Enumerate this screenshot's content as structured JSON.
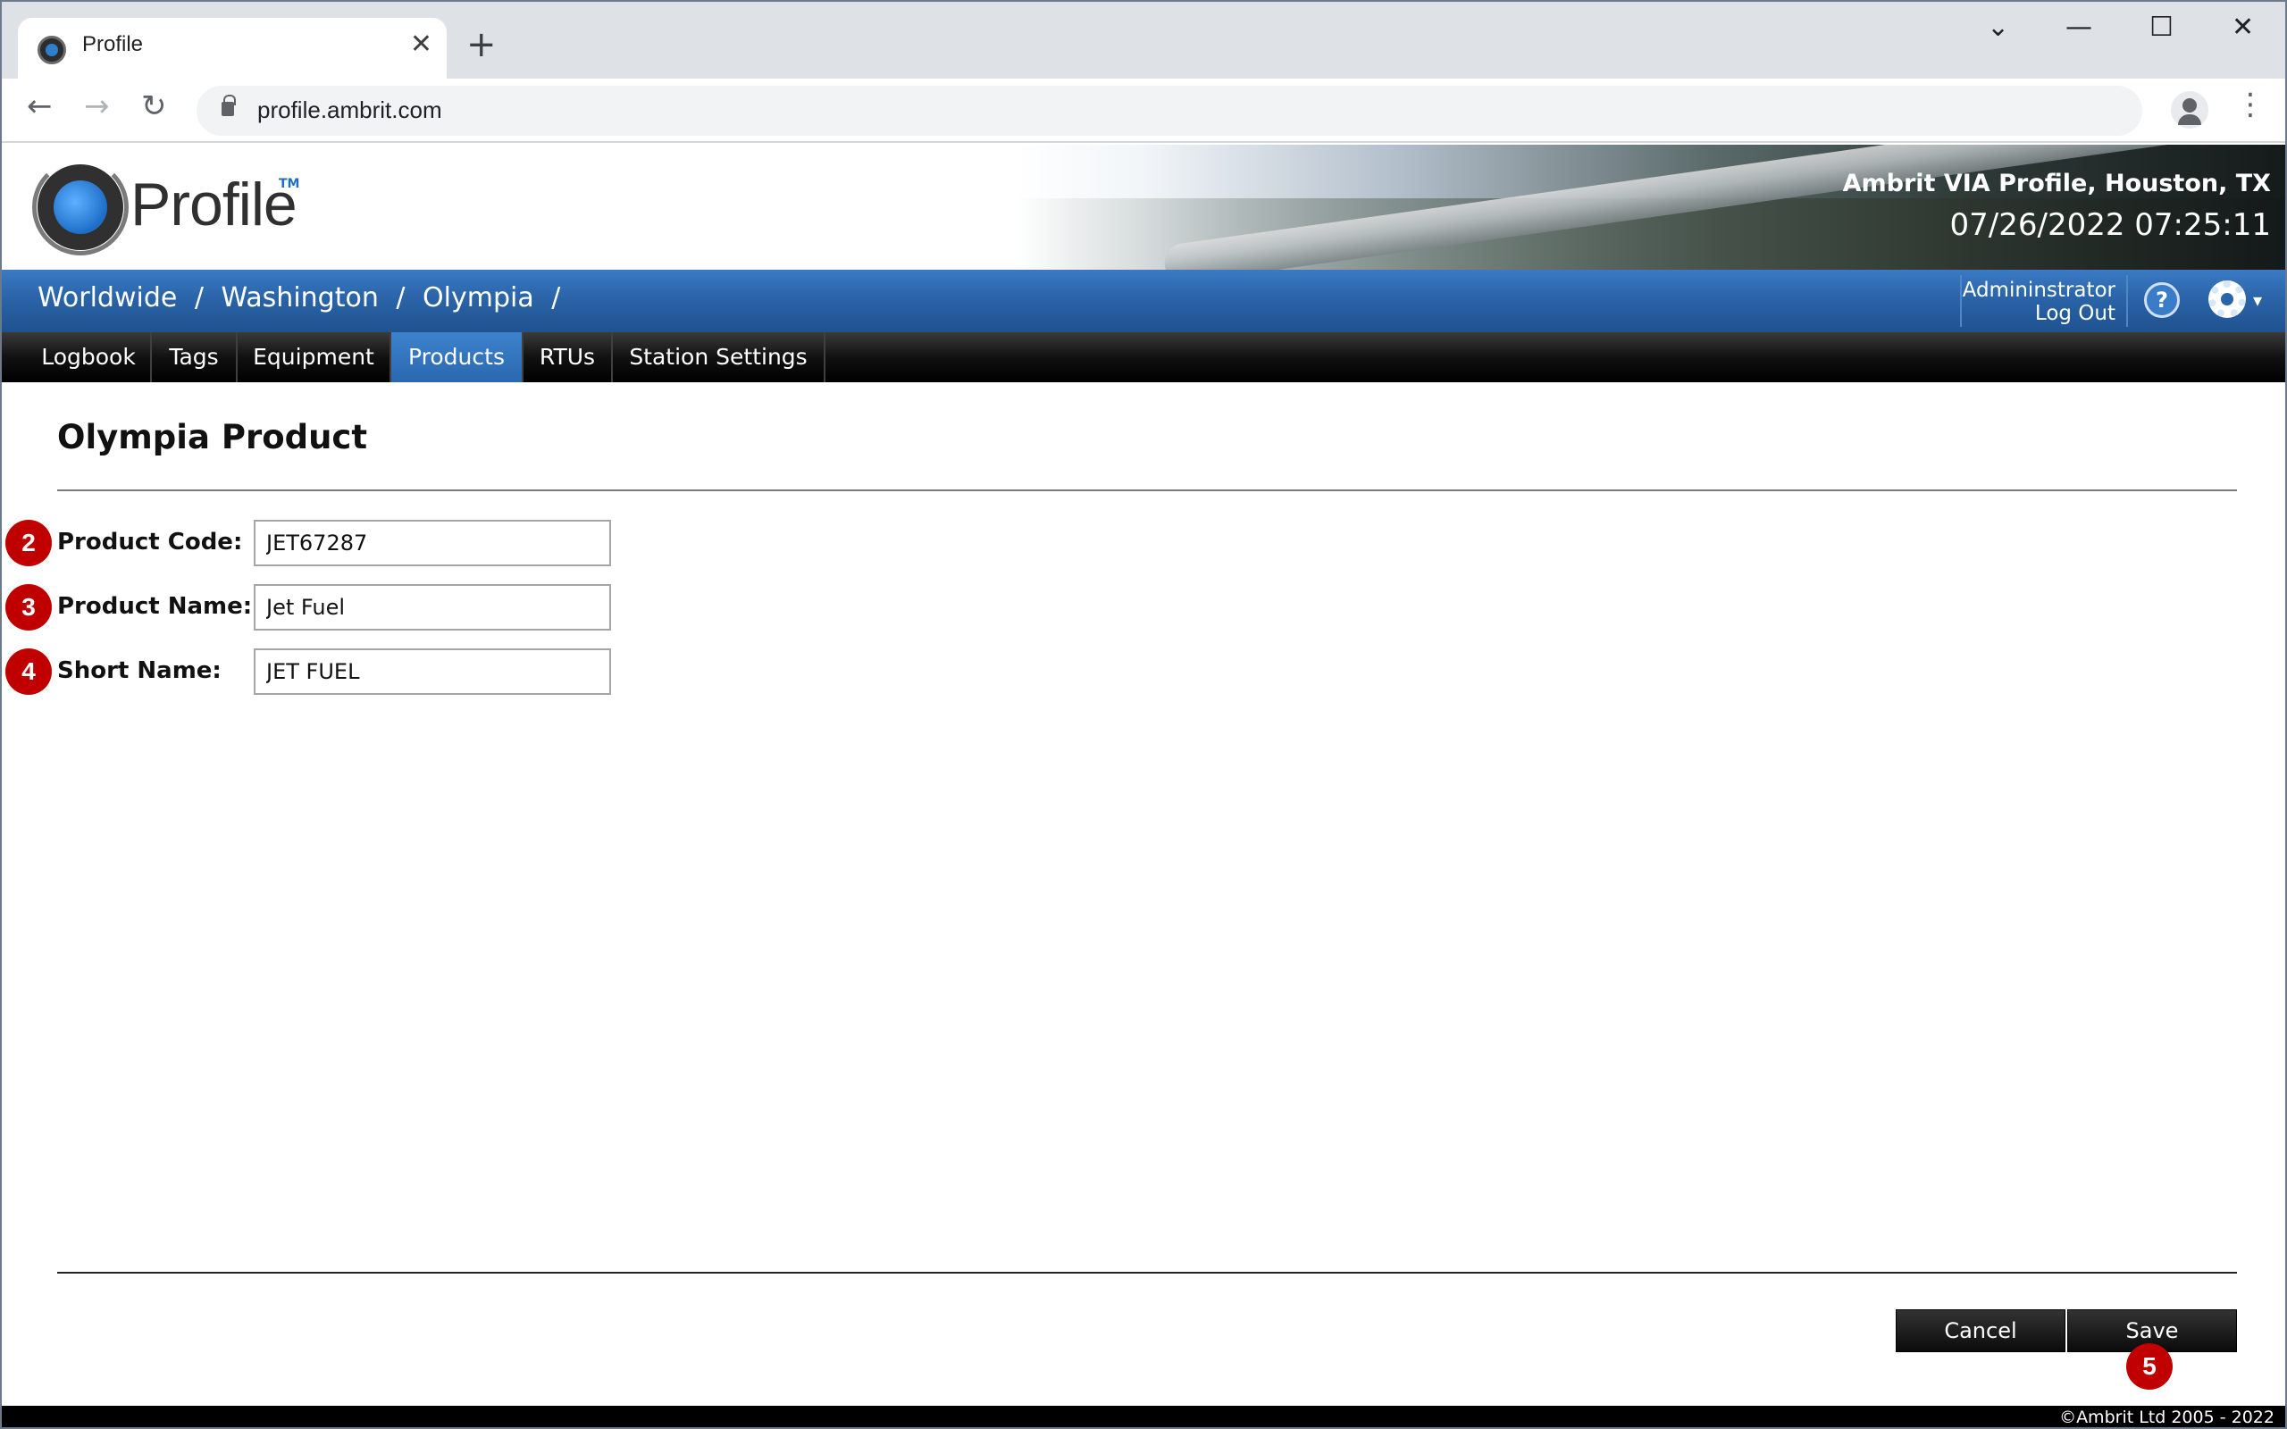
{
  "browser": {
    "tab_title": "Profile",
    "close_glyph": "✕",
    "new_tab_glyph": "+",
    "url": "profile.ambrit.com",
    "controls": {
      "dropdown": "⌄",
      "minimize": "—",
      "maximize": "☐",
      "close": "✕"
    },
    "nav": {
      "back": "←",
      "forward": "→",
      "reload": "↻",
      "menu": "⋮"
    }
  },
  "header": {
    "logo_text": "Profile",
    "logo_tm": "TM",
    "site_title": "Ambrit VIA Profile, Houston, TX",
    "clock": "07/26/2022 07:25:11"
  },
  "breadcrumb": {
    "items": [
      "Worldwide",
      "Washington",
      "Olympia"
    ],
    "separator": "/"
  },
  "user": {
    "name": "Admininstrator",
    "logout": "Log Out",
    "help_glyph": "?",
    "gear_caret": "▾"
  },
  "nav": {
    "items": [
      {
        "label": "Logbook"
      },
      {
        "label": "Tags"
      },
      {
        "label": "Equipment"
      },
      {
        "label": "Products",
        "active": true
      },
      {
        "label": "RTUs"
      },
      {
        "label": "Station Settings"
      }
    ]
  },
  "page": {
    "title": "Olympia Product",
    "fields": [
      {
        "badge": "2",
        "label": "Product Code:",
        "value": "JET67287"
      },
      {
        "badge": "3",
        "label": "Product Name:",
        "value": "Jet Fuel"
      },
      {
        "badge": "4",
        "label": "Short Name:",
        "value": "JET FUEL"
      }
    ],
    "cancel_label": "Cancel",
    "save_label": "Save",
    "save_badge": "5"
  },
  "footer": {
    "copyright": "©Ambrit Ltd 2005 - 2022"
  },
  "colors": {
    "crumb_bar": "#2a64a8",
    "nav_active": "#3d82cc",
    "badge": "#c00000"
  }
}
